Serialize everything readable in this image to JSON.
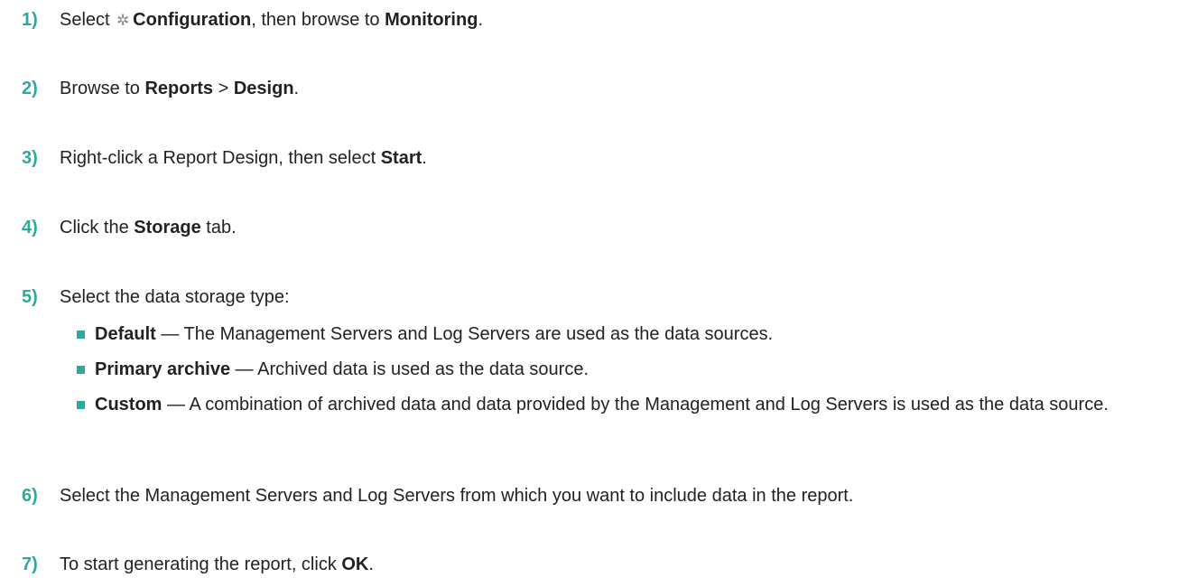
{
  "steps": [
    {
      "number": "1)",
      "prefix": "Select ",
      "bold1": "Configuration",
      "middle": ", then browse to ",
      "bold2": "Monitoring",
      "suffix": "."
    },
    {
      "number": "2)",
      "prefix": "Browse to ",
      "bold1": "Reports",
      "middle": " > ",
      "bold2": "Design",
      "suffix": "."
    },
    {
      "number": "3)",
      "prefix": "Right-click a Report Design, then select ",
      "bold1": "Start",
      "suffix": "."
    },
    {
      "number": "4)",
      "prefix": "Click the ",
      "bold1": "Storage",
      "suffix": " tab."
    },
    {
      "number": "5)",
      "text": "Select the data storage type:"
    },
    {
      "number": "6)",
      "text": "Select the Management Servers and Log Servers from which you want to include data in the report."
    },
    {
      "number": "7)",
      "prefix": "To start generating the report, click ",
      "bold1": "OK",
      "suffix": "."
    }
  ],
  "storage_options": [
    {
      "term": "Default",
      "desc": " — The Management Servers and Log Servers are used as the data sources."
    },
    {
      "term": "Primary archive",
      "desc": " — Archived data is used as the data source."
    },
    {
      "term": "Custom",
      "desc": " — A combination of archived data and data provided by the Management and Log Servers is used as the data source."
    }
  ],
  "icons": {
    "gear": "gear-icon"
  },
  "colors": {
    "accent": "#2fa8a0",
    "text": "#222222",
    "icon": "#8a8a8a"
  }
}
